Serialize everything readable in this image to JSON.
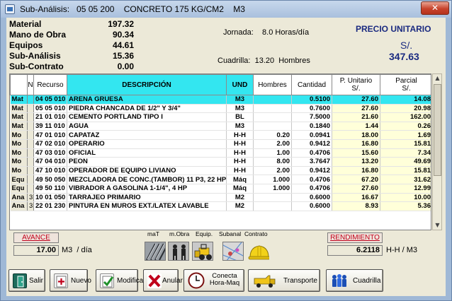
{
  "titlebar": {
    "title": "Sub-Análisis:   05 05 200    CONCRETO 175 KG/CM2    M3",
    "close_label": "✕"
  },
  "summary": [
    {
      "label": "Material",
      "value": "197.32"
    },
    {
      "label": "Mano de Obra",
      "value": "90.34"
    },
    {
      "label": "Equipos",
      "value": "44.61"
    },
    {
      "label": "Sub-Análisis",
      "value": "15.36"
    },
    {
      "label": "Sub-Contrato",
      "value": "0.00"
    }
  ],
  "jornada": "Jornada:    8.0 Horas/día",
  "cuadrilla": "Cuadrilla:  13.20  Hombres",
  "precio_unitario": {
    "title": "PRECIO UNITARIO",
    "currency": "S/.",
    "value": "347.63"
  },
  "table": {
    "headers": {
      "n": "N",
      "recurso": "Recurso",
      "descripcion": "DESCRIPCIÓN",
      "und": "UND",
      "hombres": "Hombres",
      "cantidad": "Cantidad",
      "punitario": "P. Unitario\nS/.",
      "parcial": "Parcial\nS/."
    },
    "rows": [
      {
        "tipo": "Mat",
        "n": "",
        "recurso": "04 05 010",
        "descripcion": "ARENA GRUESA",
        "und": "M3",
        "hombres": "",
        "cantidad": "0.5100",
        "punitario": "27.60",
        "parcial": "14.08",
        "selected": true
      },
      {
        "tipo": "Mat",
        "n": "",
        "recurso": "05 05 010",
        "descripcion": "PIEDRA CHANCADA DE 1/2\" Y 3/4\"",
        "und": "M3",
        "hombres": "",
        "cantidad": "0.7600",
        "punitario": "27.60",
        "parcial": "20.98"
      },
      {
        "tipo": "Mat",
        "n": "",
        "recurso": "21 01 010",
        "descripcion": "CEMENTO PORTLAND TIPO I",
        "und": "BL",
        "hombres": "",
        "cantidad": "7.5000",
        "punitario": "21.60",
        "parcial": "162.00"
      },
      {
        "tipo": "Mat",
        "n": "",
        "recurso": "39 11 010",
        "descripcion": "AGUA",
        "und": "M3",
        "hombres": "",
        "cantidad": "0.1840",
        "punitario": "1.44",
        "parcial": "0.26"
      },
      {
        "tipo": "Mo",
        "n": "",
        "recurso": "47 01 010",
        "descripcion": "CAPATAZ",
        "und": "H-H",
        "hombres": "0.20",
        "cantidad": "0.0941",
        "punitario": "18.00",
        "parcial": "1.69"
      },
      {
        "tipo": "Mo",
        "n": "",
        "recurso": "47 02 010",
        "descripcion": "OPERARIO",
        "und": "H-H",
        "hombres": "2.00",
        "cantidad": "0.9412",
        "punitario": "16.80",
        "parcial": "15.81"
      },
      {
        "tipo": "Mo",
        "n": "",
        "recurso": "47 03 010",
        "descripcion": "OFICIAL",
        "und": "H-H",
        "hombres": "1.00",
        "cantidad": "0.4706",
        "punitario": "15.60",
        "parcial": "7.34"
      },
      {
        "tipo": "Mo",
        "n": "",
        "recurso": "47 04 010",
        "descripcion": "PEON",
        "und": "H-H",
        "hombres": "8.00",
        "cantidad": "3.7647",
        "punitario": "13.20",
        "parcial": "49.69"
      },
      {
        "tipo": "Mo",
        "n": "",
        "recurso": "47 10 010",
        "descripcion": "OPERADOR DE EQUIPO LIVIANO",
        "und": "H-H",
        "hombres": "2.00",
        "cantidad": "0.9412",
        "punitario": "16.80",
        "parcial": "15.81"
      },
      {
        "tipo": "Equ",
        "n": "",
        "recurso": "49 50 050",
        "descripcion": "MEZCLADORA DE CONC.(TAMBOR) 11 P3, 22 HP",
        "und": "Máq",
        "hombres": "1.000",
        "cantidad": "0.4706",
        "punitario": "67.20",
        "parcial": "31.62"
      },
      {
        "tipo": "Equ",
        "n": "",
        "recurso": "49 50 110",
        "descripcion": "VIBRADOR A GASOLINA   1-1/4\", 4 HP",
        "und": "Máq",
        "hombres": "1.000",
        "cantidad": "0.4706",
        "punitario": "27.60",
        "parcial": "12.99"
      },
      {
        "tipo": "Ana",
        "n": "3",
        "recurso": "10 01 050",
        "descripcion": "TARRAJEO PRIMARIO",
        "und": "M2",
        "hombres": "",
        "cantidad": "0.6000",
        "punitario": "16.67",
        "parcial": "10.00"
      },
      {
        "tipo": "Ana",
        "n": "3",
        "recurso": "22 01 230",
        "descripcion": "PINTURA EN MUROS EXT./LATEX LAVABLE",
        "und": "M2",
        "hombres": "",
        "cantidad": "0.6000",
        "punitario": "8.93",
        "parcial": "5.36"
      }
    ]
  },
  "avance": {
    "label": "AVANCE",
    "value": "17.00",
    "unit": "M3  / día"
  },
  "rendimiento": {
    "label": "RENDIMIENTO",
    "value": "6.2118",
    "unit": "H-H / M3"
  },
  "tools": [
    {
      "caption": "maT",
      "icon": "steel-bars-icon"
    },
    {
      "caption": "m.Obra",
      "icon": "workers-icon"
    },
    {
      "caption": "Equip.",
      "icon": "equipment-icon"
    },
    {
      "caption": "Subanal",
      "icon": "subanalysis-icon"
    },
    {
      "caption": "Contrato",
      "icon": "hardhat-icon"
    }
  ],
  "buttons": {
    "salir": "Salir",
    "nuevo": "Nuevo",
    "modifica": "Modifica",
    "anular": "Anular",
    "conecta": "Conecta\nHora-Maq",
    "transporte": "Transporte",
    "cuadrilla": "Cuadrilla"
  },
  "colors": {
    "selection": "#33e6f0",
    "price_blue": "#1a2a80",
    "label_red": "#c0001a"
  }
}
